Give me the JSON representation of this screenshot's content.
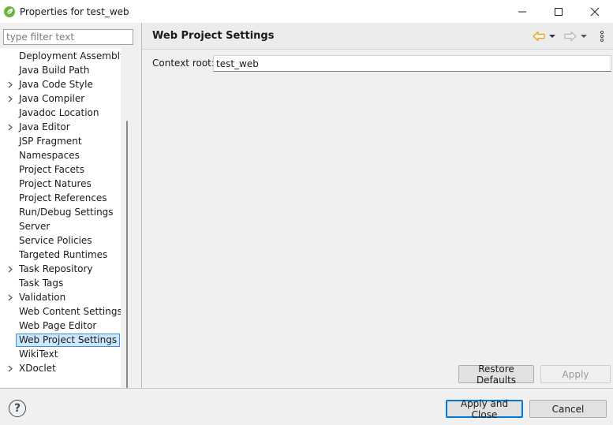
{
  "window": {
    "title": "Properties for test_web",
    "app_icon": "spring-leaf-icon",
    "controls": [
      "minimize-icon",
      "maximize-icon",
      "close-icon"
    ]
  },
  "filter": {
    "placeholder": "type filter text",
    "value": ""
  },
  "tree": {
    "items": [
      {
        "label": "Deployment Assembly",
        "expandable": false,
        "selected": false
      },
      {
        "label": "Java Build Path",
        "expandable": false,
        "selected": false
      },
      {
        "label": "Java Code Style",
        "expandable": true,
        "selected": false
      },
      {
        "label": "Java Compiler",
        "expandable": true,
        "selected": false
      },
      {
        "label": "Javadoc Location",
        "expandable": false,
        "selected": false
      },
      {
        "label": "Java Editor",
        "expandable": true,
        "selected": false
      },
      {
        "label": "JSP Fragment",
        "expandable": false,
        "selected": false
      },
      {
        "label": "Namespaces",
        "expandable": false,
        "selected": false
      },
      {
        "label": "Project Facets",
        "expandable": false,
        "selected": false
      },
      {
        "label": "Project Natures",
        "expandable": false,
        "selected": false
      },
      {
        "label": "Project References",
        "expandable": false,
        "selected": false
      },
      {
        "label": "Run/Debug Settings",
        "expandable": false,
        "selected": false
      },
      {
        "label": "Server",
        "expandable": false,
        "selected": false
      },
      {
        "label": "Service Policies",
        "expandable": false,
        "selected": false
      },
      {
        "label": "Targeted Runtimes",
        "expandable": false,
        "selected": false
      },
      {
        "label": "Task Repository",
        "expandable": true,
        "selected": false
      },
      {
        "label": "Task Tags",
        "expandable": false,
        "selected": false
      },
      {
        "label": "Validation",
        "expandable": true,
        "selected": false
      },
      {
        "label": "Web Content Settings",
        "expandable": false,
        "selected": false
      },
      {
        "label": "Web Page Editor",
        "expandable": false,
        "selected": false
      },
      {
        "label": "Web Project Settings",
        "expandable": false,
        "selected": true
      },
      {
        "label": "WikiText",
        "expandable": false,
        "selected": false
      },
      {
        "label": "XDoclet",
        "expandable": true,
        "selected": false
      }
    ]
  },
  "page": {
    "title": "Web Project Settings",
    "nav": {
      "back_icon": "back-arrow-icon",
      "forward_icon": "forward-arrow-icon",
      "menu_icon": "more-vertical-icon"
    },
    "context_root": {
      "label": "Context root:",
      "value": "test_web"
    },
    "restore_defaults_label": "Restore Defaults",
    "apply_label": "Apply"
  },
  "footer": {
    "help_icon": "help-icon",
    "help_glyph": "?",
    "apply_close_label": "Apply and Close",
    "cancel_label": "Cancel"
  },
  "colors": {
    "selection_bg": "#cce8ff",
    "selection_border": "#3d8ee0",
    "accent": "#0078d7",
    "back_arrow": "#e0a020"
  }
}
